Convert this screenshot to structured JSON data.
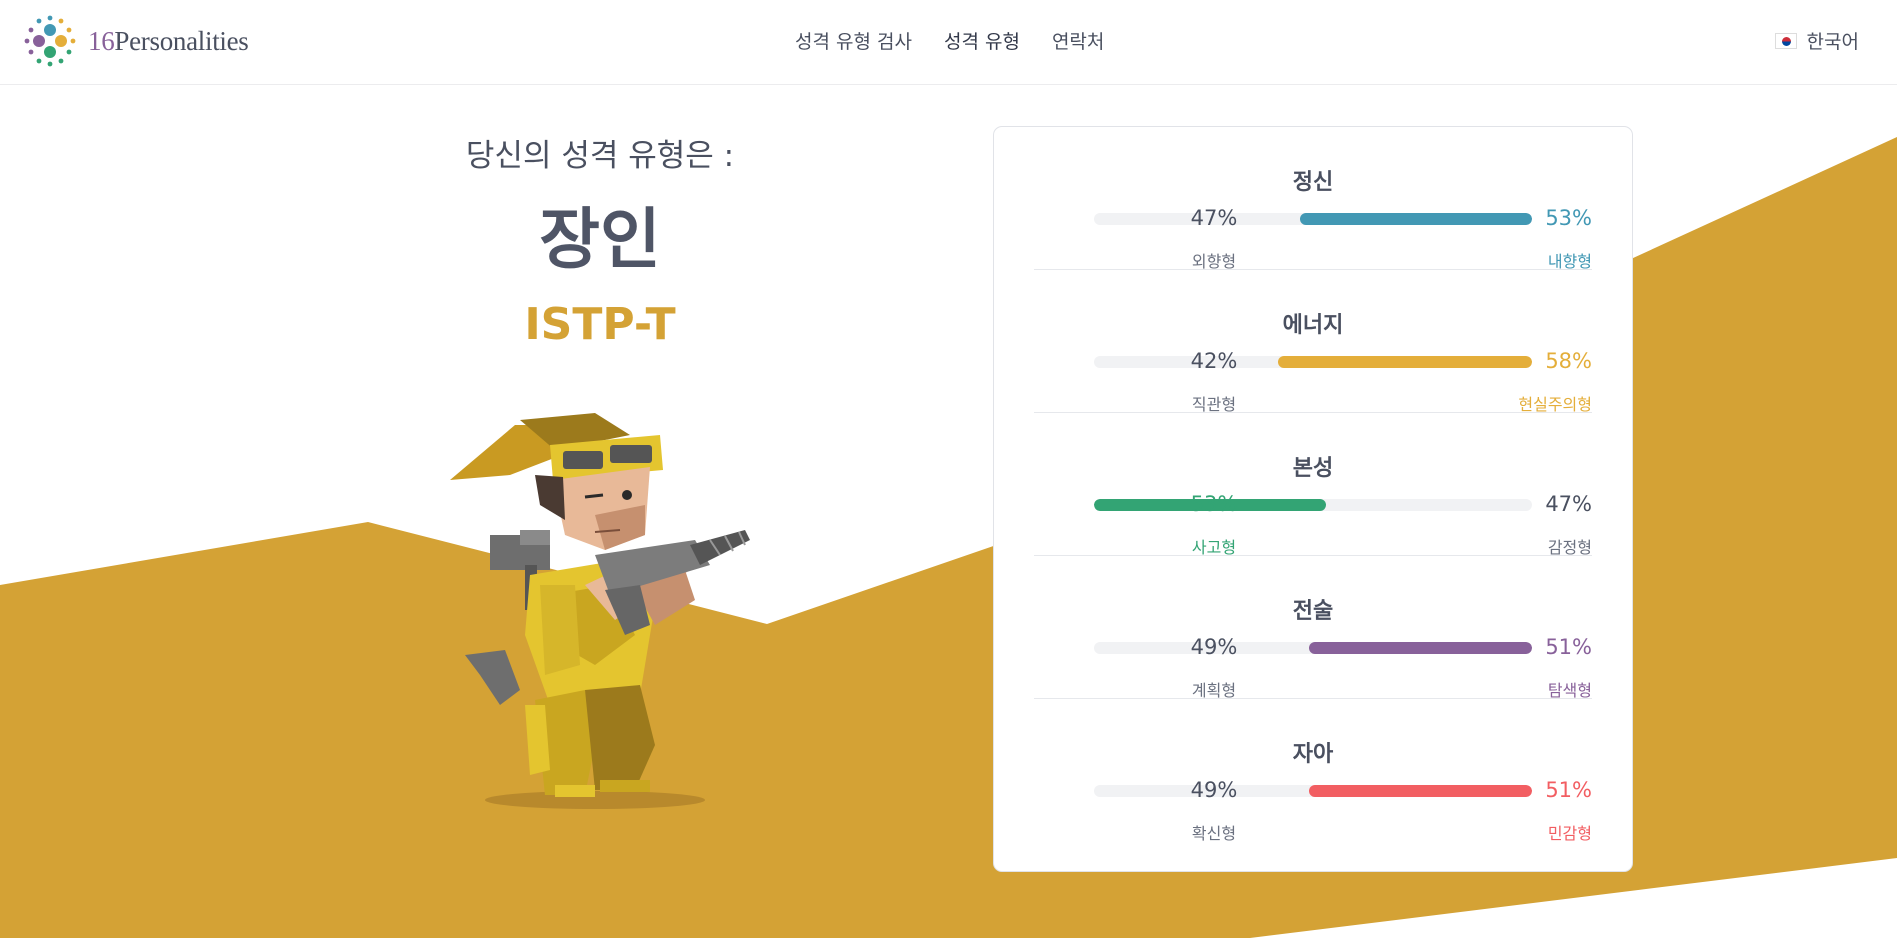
{
  "brand": {
    "logo_number": "16",
    "logo_word": "Personalities"
  },
  "nav": [
    {
      "label": "성격 유형 검사"
    },
    {
      "label": "성격 유형",
      "active": true
    },
    {
      "label": "연락처"
    }
  ],
  "language": {
    "label": "한국어"
  },
  "result": {
    "subtitle": "당신의 성격 유형은 :",
    "type_name": "장인",
    "type_code": "ISTP-T"
  },
  "theme": {
    "accent": "#d4a235"
  },
  "traits": [
    {
      "title": "정신",
      "left_pct": "47%",
      "right_pct": "53%",
      "left_label": "외향형",
      "right_label": "내향형",
      "value": 53,
      "dominant": "right",
      "color": "#4298b4"
    },
    {
      "title": "에너지",
      "left_pct": "42%",
      "right_pct": "58%",
      "left_label": "직관형",
      "right_label": "현실주의형",
      "value": 58,
      "dominant": "right",
      "color": "#e4ae3a"
    },
    {
      "title": "본성",
      "left_pct": "53%",
      "right_pct": "47%",
      "left_label": "사고형",
      "right_label": "감정형",
      "value": 53,
      "dominant": "left",
      "color": "#33a474"
    },
    {
      "title": "전술",
      "left_pct": "49%",
      "right_pct": "51%",
      "left_label": "계획형",
      "right_label": "탐색형",
      "value": 51,
      "dominant": "right",
      "color": "#88619a"
    },
    {
      "title": "자아",
      "left_pct": "49%",
      "right_pct": "51%",
      "left_label": "확신형",
      "right_label": "민감형",
      "value": 51,
      "dominant": "right",
      "color": "#f25e62"
    }
  ]
}
